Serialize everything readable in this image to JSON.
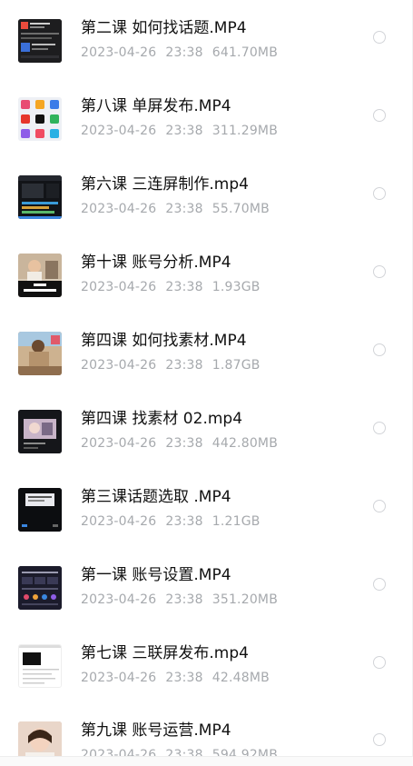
{
  "files": [
    {
      "name": "第二课 如何找话题.MP4",
      "date": "2023-04-26",
      "time": "23:38",
      "size": "641.70MB",
      "thumb": "dark-phone-screenshot"
    },
    {
      "name": "第八课 单屏发布.MP4",
      "date": "2023-04-26",
      "time": "23:38",
      "size": "311.29MB",
      "thumb": "app-icons-grid"
    },
    {
      "name": "第六课 三连屏制作.mp4",
      "date": "2023-04-26",
      "time": "23:38",
      "size": "55.70MB",
      "thumb": "video-editor"
    },
    {
      "name": "第十课 账号分析.MP4",
      "date": "2023-04-26",
      "time": "23:38",
      "size": "1.93GB",
      "thumb": "person-frame"
    },
    {
      "name": "第四课 如何找素材.MP4",
      "date": "2023-04-26",
      "time": "23:38",
      "size": "1.87GB",
      "thumb": "outdoor-photo"
    },
    {
      "name": "第四课 找素材 02.mp4",
      "date": "2023-04-26",
      "time": "23:38",
      "size": "442.80MB",
      "thumb": "dark-video-frame"
    },
    {
      "name": "第三课话题选取 .MP4",
      "date": "2023-04-26",
      "time": "23:38",
      "size": "1.21GB",
      "thumb": "dark-dialog"
    },
    {
      "name": "第一课 账号设置.MP4",
      "date": "2023-04-26",
      "time": "23:38",
      "size": "351.20MB",
      "thumb": "dark-stats"
    },
    {
      "name": "第七课 三联屏发布.mp4",
      "date": "2023-04-26",
      "time": "23:38",
      "size": "42.48MB",
      "thumb": "white-page"
    },
    {
      "name": "第九课 账号运营.MP4",
      "date": "2023-04-26",
      "time": "23:38",
      "size": "594.92MB",
      "thumb": "portrait"
    }
  ],
  "colors": {
    "name_text": "#111111",
    "meta_text": "#a6a9ad",
    "radio_border": "#d2d4d8"
  },
  "icons": {
    "select": "radio-unchecked-icon"
  }
}
